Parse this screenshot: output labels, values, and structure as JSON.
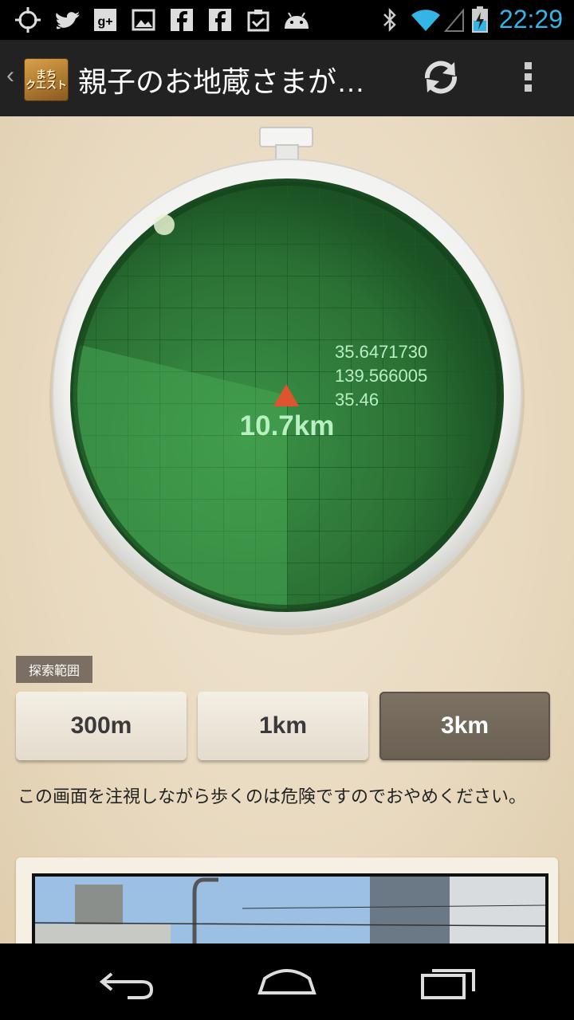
{
  "status_bar": {
    "time": "22:29",
    "icons": [
      "gps-icon",
      "twitter-icon",
      "google-plus-icon",
      "gallery-icon",
      "facebook-icon",
      "facebook-icon",
      "clipboard-check-icon",
      "android-icon",
      "bluetooth-icon",
      "wifi-icon",
      "signal-icon",
      "battery-charging-icon"
    ]
  },
  "action_bar": {
    "title": "親子のお地蔵さまが…",
    "logo_text": "まち\nクエスト",
    "refresh_icon": "refresh-icon",
    "menu_icon": "overflow-menu-icon"
  },
  "radar": {
    "latitude": "35.6471730",
    "longitude": "139.566005",
    "altitude": "35.46",
    "distance": "10.7km",
    "colors": {
      "screen": "#2f7a3a",
      "target": "#e0532f",
      "text": "#b8f0c2"
    }
  },
  "search_range": {
    "label": "探索範囲",
    "options": [
      "300m",
      "1km",
      "3km"
    ],
    "selected": "3km"
  },
  "warning_text": "この画面を注視しながら歩くのは危険ですのでおやめください。",
  "nav_bar": {
    "icons": [
      "back-icon",
      "home-icon",
      "recent-apps-icon"
    ]
  }
}
